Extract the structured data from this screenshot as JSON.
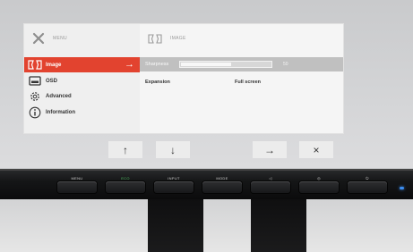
{
  "osd": {
    "header_left": "MENU",
    "header_right": "IMAGE",
    "menu_items": [
      {
        "label": "Image",
        "icon": "image-icon",
        "selected": true
      },
      {
        "label": "OSD",
        "icon": "osd-icon",
        "selected": false
      },
      {
        "label": "Advanced",
        "icon": "gear-icon",
        "selected": false
      },
      {
        "label": "Information",
        "icon": "info-icon",
        "selected": false
      }
    ],
    "settings": [
      {
        "label": "Sharpness",
        "value": "50",
        "level": 0.55,
        "dimmed": true
      },
      {
        "label": "Expansion",
        "value": "Full screen",
        "dimmed": false
      }
    ],
    "nav_buttons": [
      "↑",
      "↓",
      "→",
      "×"
    ],
    "accent_color": "#e2432f"
  },
  "bezel": {
    "buttons": [
      {
        "label": "MENU",
        "highlight": false
      },
      {
        "label": "ECO",
        "highlight": true
      },
      {
        "label": "INPUT",
        "highlight": false
      },
      {
        "label": "MODE",
        "highlight": false
      },
      {
        "label": "◁",
        "highlight": false
      },
      {
        "label": "◎",
        "highlight": false
      },
      {
        "label": "⏻",
        "highlight": false
      }
    ],
    "led_color": "#3c8df0"
  }
}
